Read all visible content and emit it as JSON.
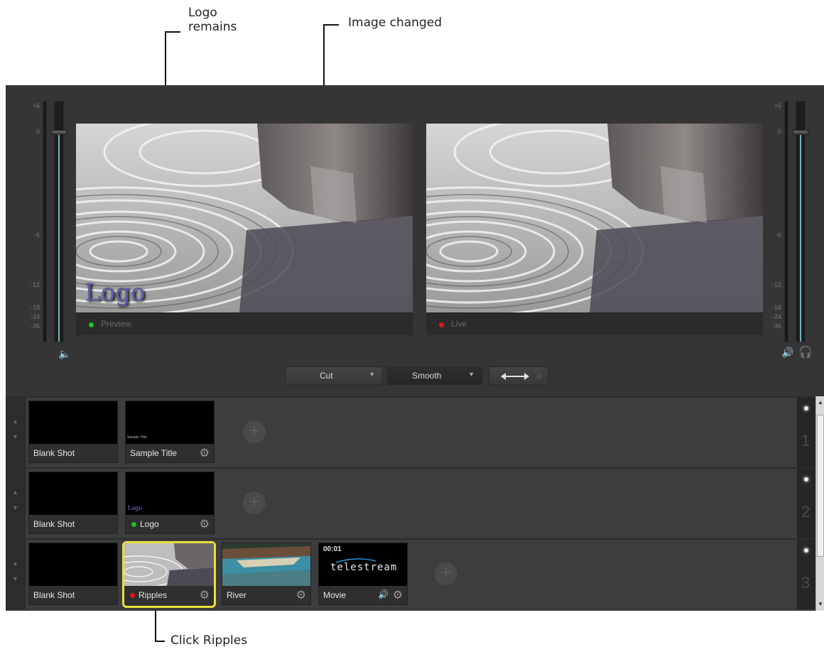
{
  "callouts": {
    "logo_remains_line1": "Logo",
    "logo_remains_line2": "remains",
    "image_changed": "Image changed",
    "click_ripples": "Click Ripples"
  },
  "vu_scale": [
    "+6",
    "0",
    "-6",
    "-12",
    "-18",
    "-24",
    "-36"
  ],
  "monitors": {
    "preview": {
      "label": "Preview",
      "dot_color": "#1ec21e",
      "overlay_text": "Logo"
    },
    "live": {
      "label": "Live",
      "dot_color": "#e01818"
    }
  },
  "transitions": {
    "cut_label": "Cut",
    "smooth_label": "Smooth",
    "swap_icon": "swap-arrows-icon"
  },
  "icons": {
    "mute": "speaker-mute-icon",
    "volume": "speaker-icon",
    "headphones": "headphones-icon",
    "gear": "gear-icon",
    "plus": "plus-icon"
  },
  "layers": [
    {
      "number": "1",
      "shots": [
        {
          "name": "Blank Shot"
        },
        {
          "name": "Sample Title",
          "thumb_text": "Sample Title"
        }
      ]
    },
    {
      "number": "2",
      "shots": [
        {
          "name": "Blank Shot"
        },
        {
          "name": "Logo",
          "thumb_text": "Logo",
          "dot_color": "#1ec21e"
        }
      ]
    },
    {
      "number": "3",
      "shots": [
        {
          "name": "Blank Shot"
        },
        {
          "name": "Ripples",
          "dot_color": "#e01818",
          "selected": true
        },
        {
          "name": "River"
        },
        {
          "name": "Movie",
          "timecode": "00:01",
          "brand": "telestream"
        }
      ]
    }
  ],
  "colors": {
    "selection": "#e8df3a",
    "live": "#e01818",
    "preview": "#1ec21e",
    "meter": "#6fb4b8"
  }
}
